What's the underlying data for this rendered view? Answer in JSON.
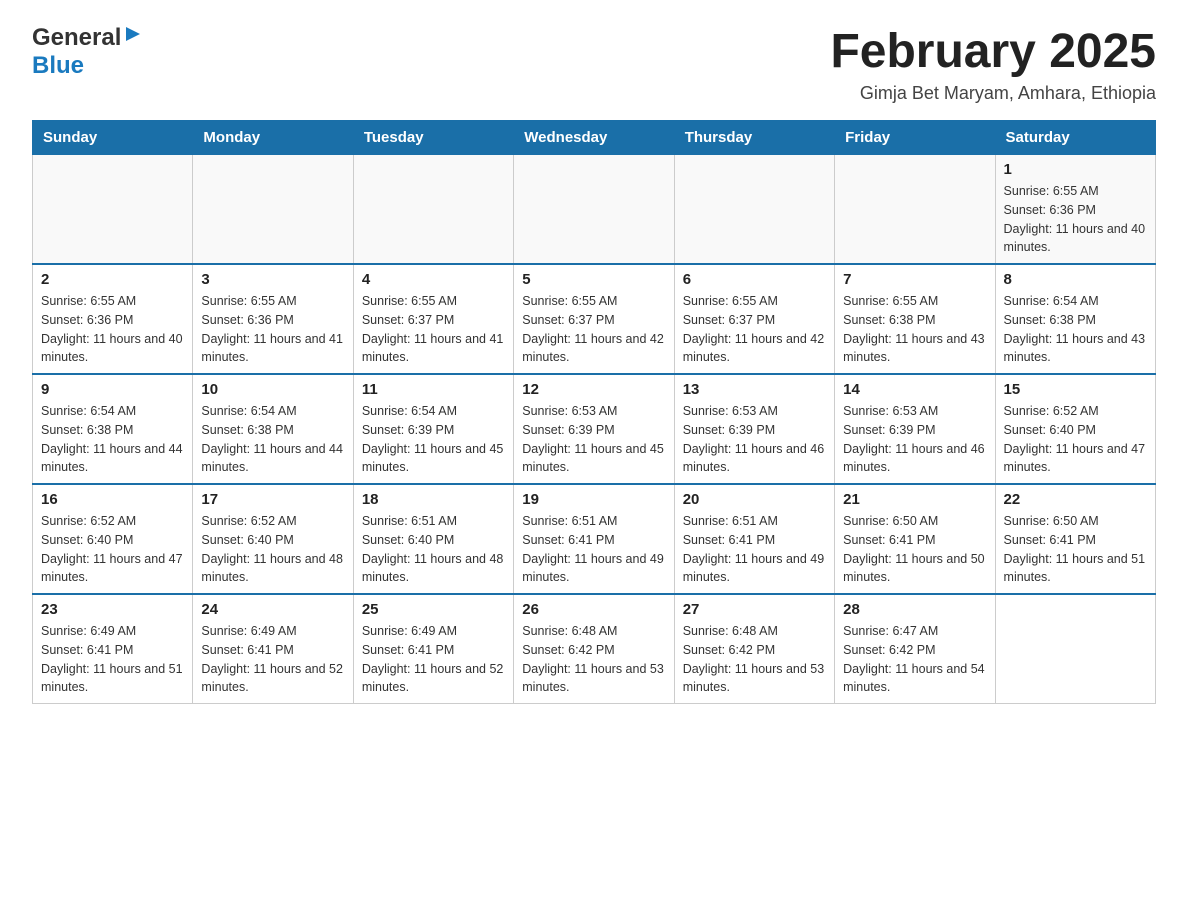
{
  "logo": {
    "general": "General",
    "blue": "Blue"
  },
  "title": "February 2025",
  "subtitle": "Gimja Bet Maryam, Amhara, Ethiopia",
  "days_of_week": [
    "Sunday",
    "Monday",
    "Tuesday",
    "Wednesday",
    "Thursday",
    "Friday",
    "Saturday"
  ],
  "weeks": [
    [
      {
        "day": "",
        "info": ""
      },
      {
        "day": "",
        "info": ""
      },
      {
        "day": "",
        "info": ""
      },
      {
        "day": "",
        "info": ""
      },
      {
        "day": "",
        "info": ""
      },
      {
        "day": "",
        "info": ""
      },
      {
        "day": "1",
        "info": "Sunrise: 6:55 AM\nSunset: 6:36 PM\nDaylight: 11 hours and 40 minutes."
      }
    ],
    [
      {
        "day": "2",
        "info": "Sunrise: 6:55 AM\nSunset: 6:36 PM\nDaylight: 11 hours and 40 minutes."
      },
      {
        "day": "3",
        "info": "Sunrise: 6:55 AM\nSunset: 6:36 PM\nDaylight: 11 hours and 41 minutes."
      },
      {
        "day": "4",
        "info": "Sunrise: 6:55 AM\nSunset: 6:37 PM\nDaylight: 11 hours and 41 minutes."
      },
      {
        "day": "5",
        "info": "Sunrise: 6:55 AM\nSunset: 6:37 PM\nDaylight: 11 hours and 42 minutes."
      },
      {
        "day": "6",
        "info": "Sunrise: 6:55 AM\nSunset: 6:37 PM\nDaylight: 11 hours and 42 minutes."
      },
      {
        "day": "7",
        "info": "Sunrise: 6:55 AM\nSunset: 6:38 PM\nDaylight: 11 hours and 43 minutes."
      },
      {
        "day": "8",
        "info": "Sunrise: 6:54 AM\nSunset: 6:38 PM\nDaylight: 11 hours and 43 minutes."
      }
    ],
    [
      {
        "day": "9",
        "info": "Sunrise: 6:54 AM\nSunset: 6:38 PM\nDaylight: 11 hours and 44 minutes."
      },
      {
        "day": "10",
        "info": "Sunrise: 6:54 AM\nSunset: 6:38 PM\nDaylight: 11 hours and 44 minutes."
      },
      {
        "day": "11",
        "info": "Sunrise: 6:54 AM\nSunset: 6:39 PM\nDaylight: 11 hours and 45 minutes."
      },
      {
        "day": "12",
        "info": "Sunrise: 6:53 AM\nSunset: 6:39 PM\nDaylight: 11 hours and 45 minutes."
      },
      {
        "day": "13",
        "info": "Sunrise: 6:53 AM\nSunset: 6:39 PM\nDaylight: 11 hours and 46 minutes."
      },
      {
        "day": "14",
        "info": "Sunrise: 6:53 AM\nSunset: 6:39 PM\nDaylight: 11 hours and 46 minutes."
      },
      {
        "day": "15",
        "info": "Sunrise: 6:52 AM\nSunset: 6:40 PM\nDaylight: 11 hours and 47 minutes."
      }
    ],
    [
      {
        "day": "16",
        "info": "Sunrise: 6:52 AM\nSunset: 6:40 PM\nDaylight: 11 hours and 47 minutes."
      },
      {
        "day": "17",
        "info": "Sunrise: 6:52 AM\nSunset: 6:40 PM\nDaylight: 11 hours and 48 minutes."
      },
      {
        "day": "18",
        "info": "Sunrise: 6:51 AM\nSunset: 6:40 PM\nDaylight: 11 hours and 48 minutes."
      },
      {
        "day": "19",
        "info": "Sunrise: 6:51 AM\nSunset: 6:41 PM\nDaylight: 11 hours and 49 minutes."
      },
      {
        "day": "20",
        "info": "Sunrise: 6:51 AM\nSunset: 6:41 PM\nDaylight: 11 hours and 49 minutes."
      },
      {
        "day": "21",
        "info": "Sunrise: 6:50 AM\nSunset: 6:41 PM\nDaylight: 11 hours and 50 minutes."
      },
      {
        "day": "22",
        "info": "Sunrise: 6:50 AM\nSunset: 6:41 PM\nDaylight: 11 hours and 51 minutes."
      }
    ],
    [
      {
        "day": "23",
        "info": "Sunrise: 6:49 AM\nSunset: 6:41 PM\nDaylight: 11 hours and 51 minutes."
      },
      {
        "day": "24",
        "info": "Sunrise: 6:49 AM\nSunset: 6:41 PM\nDaylight: 11 hours and 52 minutes."
      },
      {
        "day": "25",
        "info": "Sunrise: 6:49 AM\nSunset: 6:41 PM\nDaylight: 11 hours and 52 minutes."
      },
      {
        "day": "26",
        "info": "Sunrise: 6:48 AM\nSunset: 6:42 PM\nDaylight: 11 hours and 53 minutes."
      },
      {
        "day": "27",
        "info": "Sunrise: 6:48 AM\nSunset: 6:42 PM\nDaylight: 11 hours and 53 minutes."
      },
      {
        "day": "28",
        "info": "Sunrise: 6:47 AM\nSunset: 6:42 PM\nDaylight: 11 hours and 54 minutes."
      },
      {
        "day": "",
        "info": ""
      }
    ]
  ]
}
